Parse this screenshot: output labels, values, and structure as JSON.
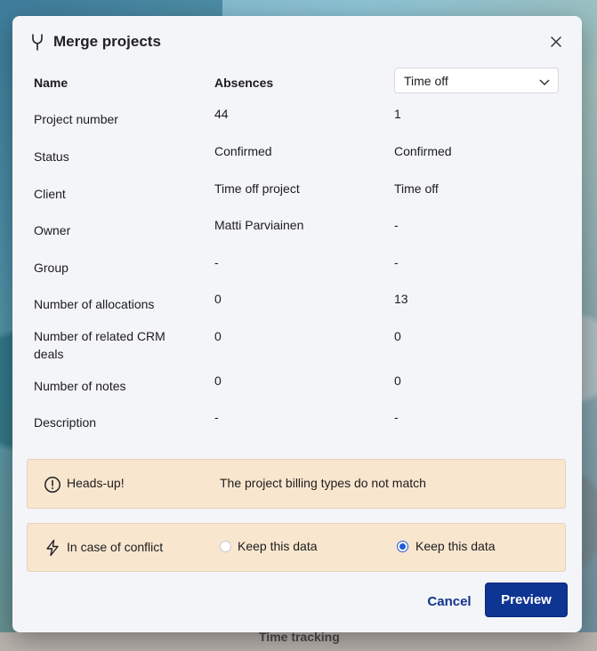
{
  "background": {
    "time_tracking": "Time tracking"
  },
  "dialog": {
    "title": "Merge projects",
    "icon": "merge-icon",
    "close_icon": "close-icon",
    "header": {
      "name": "Name",
      "left_project": "Absences",
      "right_select": "Time off"
    },
    "rows": [
      {
        "label": "Project number",
        "left": "44",
        "right": "1"
      },
      {
        "label": "Status",
        "left": "Confirmed",
        "right": "Confirmed"
      },
      {
        "label": "Client",
        "left": "Time off project",
        "right": "Time off"
      },
      {
        "label": "Owner",
        "left": "Matti Parviainen",
        "right": "-"
      },
      {
        "label": "Group",
        "left": "-",
        "right": "-"
      },
      {
        "label": "Number of allocations",
        "left": "0",
        "right": "13"
      },
      {
        "label": "Number of related CRM deals",
        "left": "0",
        "right": "0"
      },
      {
        "label": "Number of notes",
        "left": "0",
        "right": "0"
      },
      {
        "label": "Description",
        "left": "-",
        "right": "-"
      }
    ],
    "notice": {
      "label": "Heads-up!",
      "message": "The project billing types do not match"
    },
    "conflict": {
      "label": "In case of conflict",
      "left_option": "Keep this data",
      "right_option": "Keep this data",
      "selected": "right"
    },
    "buttons": {
      "cancel": "Cancel",
      "preview": "Preview"
    },
    "colors": {
      "primary": "#0f3592",
      "notice_bg": "#f9e6cf",
      "radio_selected": "#1f5bd6"
    }
  }
}
